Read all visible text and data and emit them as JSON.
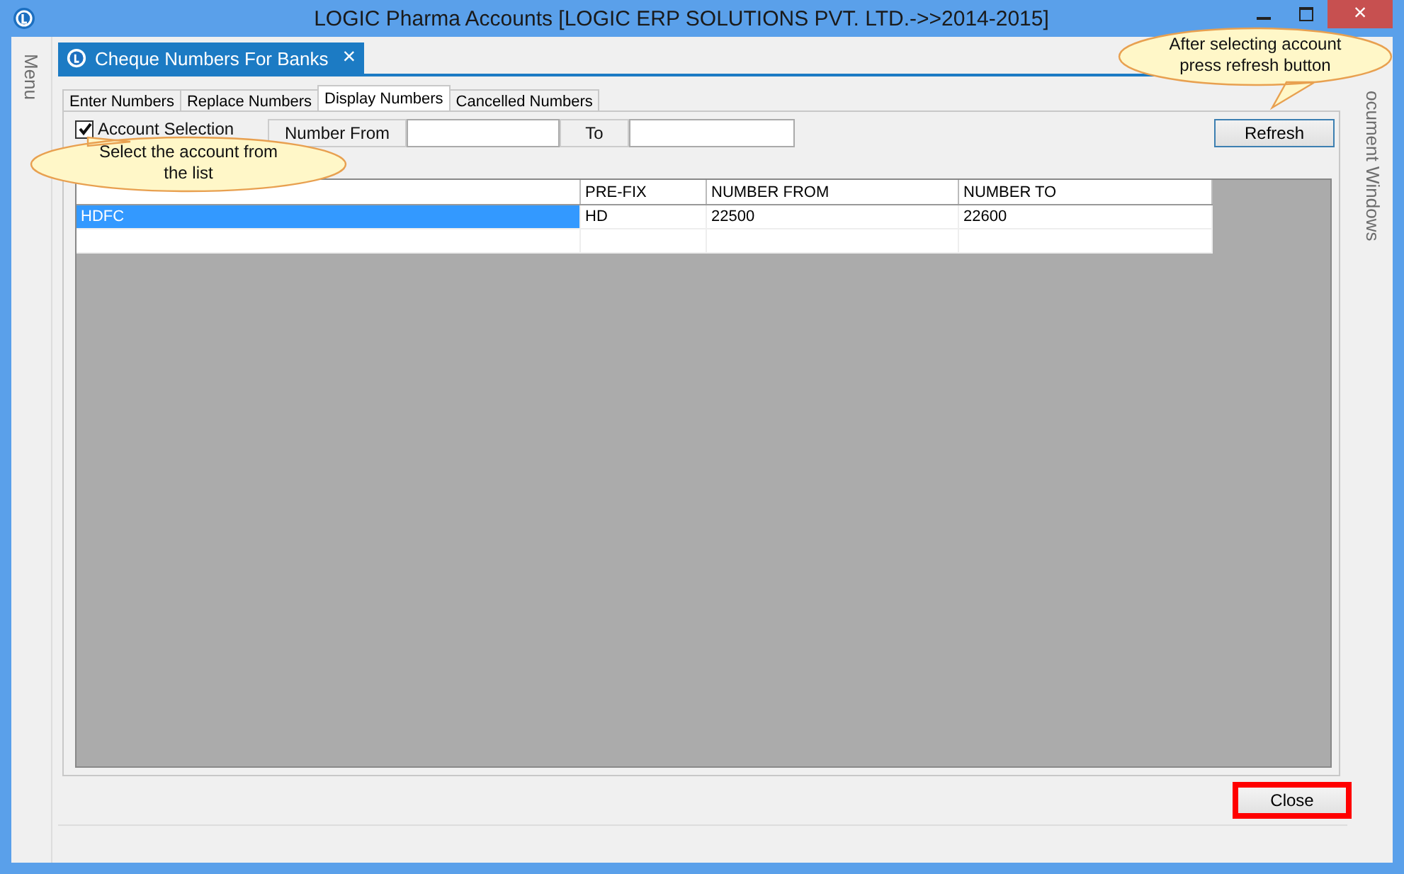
{
  "window": {
    "title": "LOGIC Pharma Accounts  [LOGIC ERP SOLUTIONS PVT. LTD.->>2014-2015]",
    "close_glyph": "×"
  },
  "left_panel": {
    "label": "Menu"
  },
  "right_panel": {
    "label": "ocument Windows"
  },
  "document_tab": {
    "label": "Cheque Numbers For Banks",
    "close_glyph": "×"
  },
  "tabs": [
    {
      "label": "Enter Numbers",
      "selected": false
    },
    {
      "label": "Replace Numbers",
      "selected": false
    },
    {
      "label": "Display Numbers",
      "selected": true
    },
    {
      "label": "Cancelled Numbers",
      "selected": false
    }
  ],
  "filter": {
    "account_selection": {
      "label": "Account Selection",
      "checked": true
    },
    "number_from_label": "Number From",
    "to_label": "To",
    "refresh_button": "Refresh"
  },
  "table": {
    "columns": [
      "",
      "PRE-FIX",
      "NUMBER FROM",
      "NUMBER TO"
    ],
    "rows": [
      {
        "cells": [
          "HDFC",
          "HD",
          "22500",
          "22600"
        ],
        "selected": true
      }
    ]
  },
  "close_button": "Close",
  "callouts": [
    {
      "text": "Select the account from the list"
    },
    {
      "text": "After selecting account press refresh button"
    }
  ]
}
